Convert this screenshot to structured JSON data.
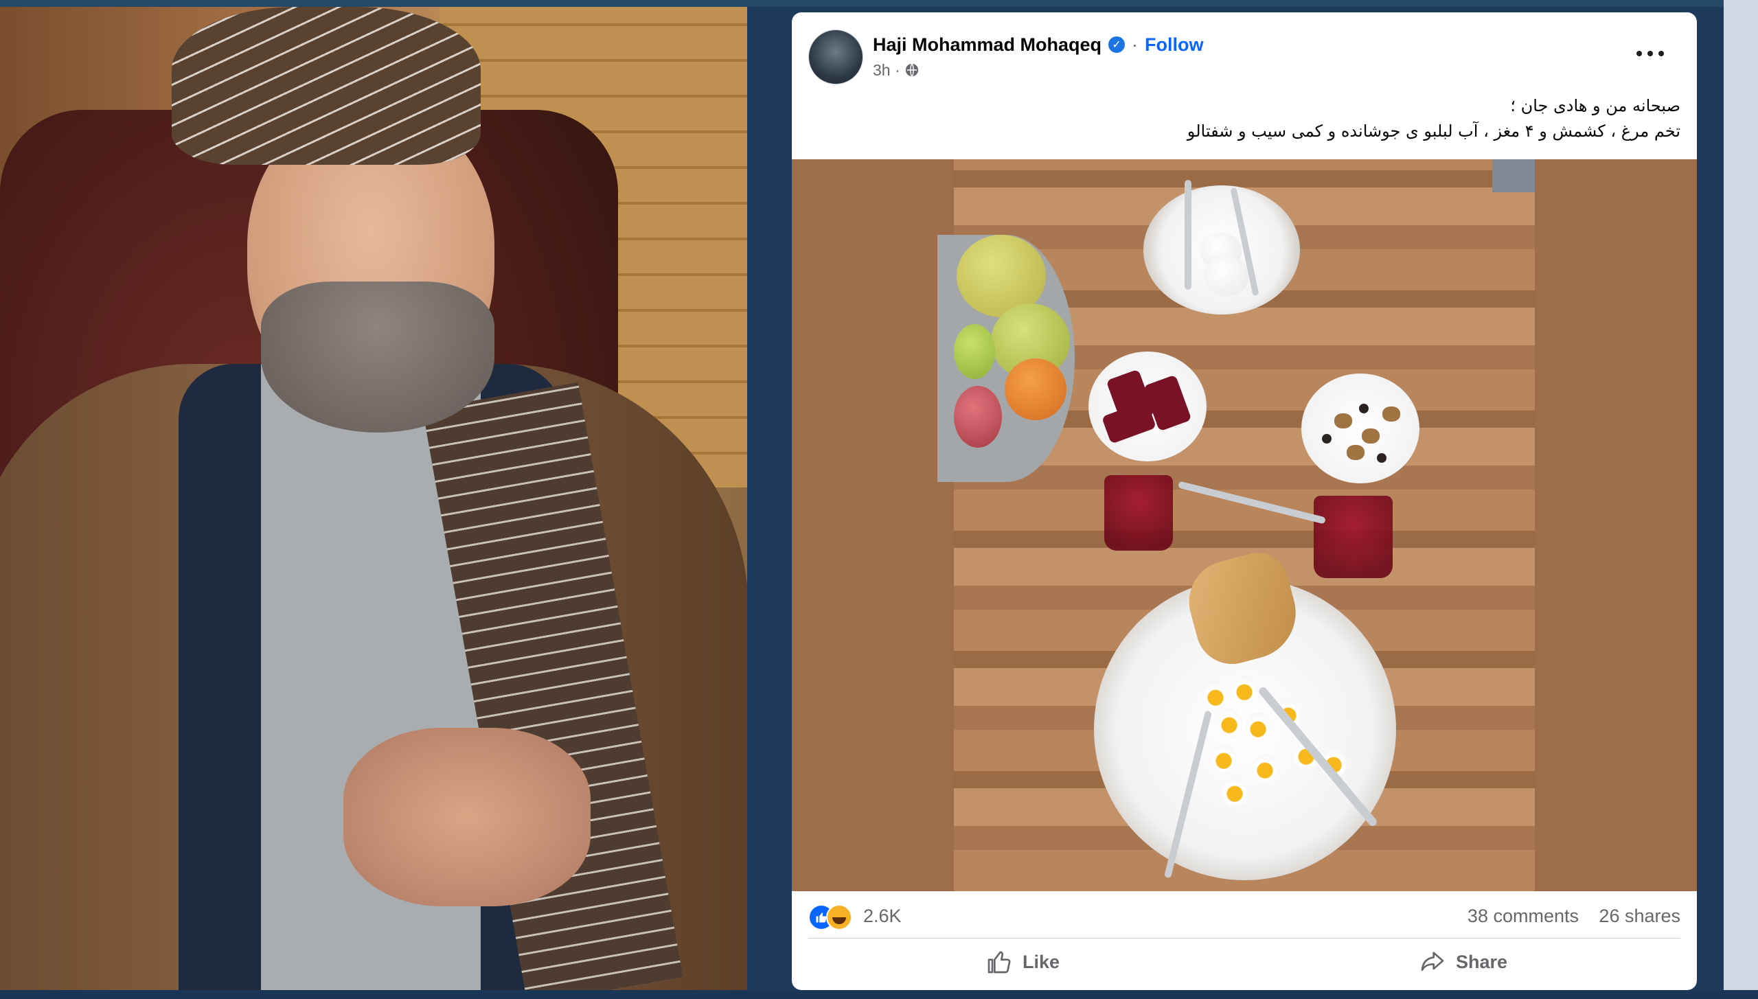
{
  "post": {
    "author_name": "Haji Mohammad Mohaqeq",
    "separator": "·",
    "follow_label": "Follow",
    "timestamp": "3h ·",
    "caption_lines": [
      "صبحانه من و هادی جان ؛",
      "تخم مرغ ، کشمش و ۴ مغز ، آب لبلبو ی جوشانده  و کمی سیب و شفتالو"
    ]
  },
  "engagement": {
    "reaction_count": "2.6K",
    "comments": "38 comments",
    "shares": "26 shares"
  },
  "actions": {
    "like_label": "Like",
    "share_label": "Share"
  },
  "colors": {
    "accent": "#0866ff",
    "secondary_text": "#65676b",
    "page_background": "#1d3a5c"
  },
  "icons": [
    "verified-badge-icon",
    "globe-icon",
    "more-options-icon",
    "like-reaction-icon",
    "haha-reaction-icon",
    "thumbs-up-icon",
    "share-arrow-icon"
  ]
}
